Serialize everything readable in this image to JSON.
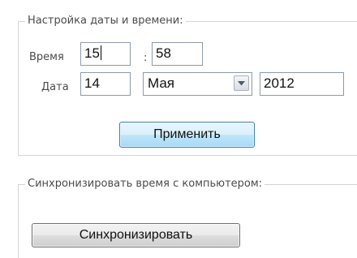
{
  "datetime_group": {
    "title": "Настройка даты и времени:",
    "time_label": "Время",
    "hours": "15",
    "time_separator": ":",
    "minutes": "58",
    "date_label": "Дата",
    "day": "14",
    "month": "Мая",
    "year": "2012",
    "apply_label": "Применить"
  },
  "sync_group": {
    "title": "Синхронизировать время с компьютером:",
    "sync_label": "Синхронизировать"
  },
  "icons": {
    "dropdown": "chevron-down-icon"
  },
  "colors": {
    "apply_button_border": "#3c7fb1",
    "apply_button_fill": "#bee6fd",
    "field_border": "#8e9aa6",
    "group_border": "#d4d4d4"
  }
}
